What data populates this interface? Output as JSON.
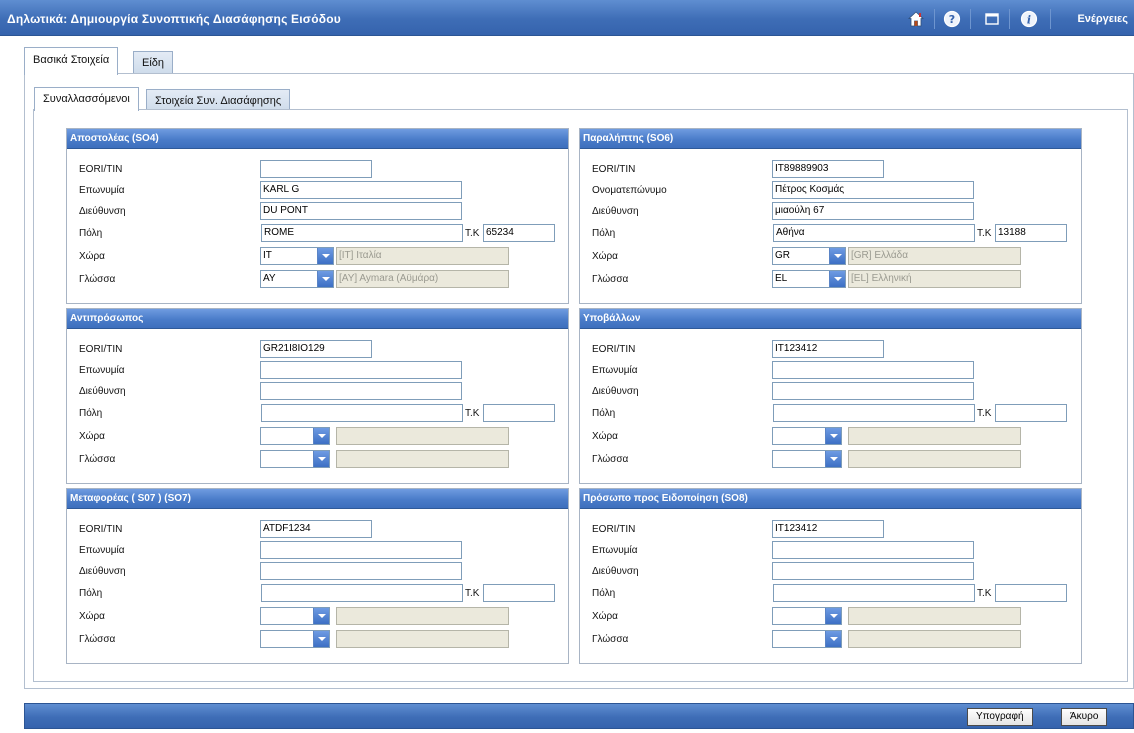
{
  "window": {
    "title": "Δηλωτικά: Δημιουργία Συνοπτικής Διασάφησης Εισόδου",
    "actions_label": "Ενέργειες",
    "icons": [
      "home-icon",
      "help-icon",
      "window-icon",
      "info-icon"
    ]
  },
  "tabs": {
    "main": [
      "Βασικά Στοιχεία",
      "Είδη"
    ],
    "sub": [
      "Συναλλασσόμενοι",
      "Στοιχεία Συν. Διασάφησης"
    ]
  },
  "labels": {
    "eori": "EORI/TIN",
    "eponymia": "Επωνυμία",
    "onomateponymo": "Ονοματεπώνυμο",
    "address": "Διεύθυνση",
    "city": "Πόλη",
    "postcode": "Τ.Κ",
    "country": "Χώρα",
    "language": "Γλώσσα"
  },
  "sections": {
    "sender": {
      "title": "Αποστολέας (SO4)",
      "eori": "",
      "name": "KARL G",
      "address": "DU PONT",
      "city": "ROME",
      "postcode": "65234",
      "country_code": "IT",
      "country_name": "[IT] Ιταλία",
      "language_code": "AY",
      "language_name": "[AY] Aymara (Αϋμάρα)"
    },
    "receiver": {
      "title": "Παραλήπτης (SO6)",
      "eori": "IT89889903",
      "name": "Πέτρος Κοσμάς",
      "address": "μιαούλη 67",
      "city": "Αθήνα",
      "postcode": "13188",
      "country_code": "GR",
      "country_name": "[GR] Ελλάδα",
      "language_code": "EL",
      "language_name": "[EL] Ελληνική"
    },
    "representative": {
      "title": "Αντιπρόσωπος",
      "eori": "GR21I8IO129",
      "name": "",
      "address": "",
      "city": "",
      "postcode": "",
      "country_code": "",
      "country_name": "",
      "language_code": "",
      "language_name": ""
    },
    "submitter": {
      "title": "Υποβάλλων",
      "eori": "IT123412",
      "name": "",
      "address": "",
      "city": "",
      "postcode": "",
      "country_code": "",
      "country_name": "",
      "language_code": "",
      "language_name": ""
    },
    "carrier": {
      "title": "Μεταφορέας ( S07 ) (SO7)",
      "eori": "ATDF1234",
      "name": "",
      "address": "",
      "city": "",
      "postcode": "",
      "country_code": "",
      "country_name": "",
      "language_code": "",
      "language_name": ""
    },
    "notify": {
      "title": "Πρόσωπο προς Ειδοποίηση (SO8)",
      "eori": "IT123412",
      "name": "",
      "address": "",
      "city": "",
      "postcode": "",
      "country_code": "",
      "country_name": "",
      "language_code": "",
      "language_name": ""
    }
  },
  "footer": {
    "sign_label": "Υπογραφή",
    "cancel_label": "Άκυρο"
  },
  "colors": {
    "header_blue": "#3e6db6",
    "section_header_blue": "#4a7cc9",
    "readonly_bg": "#ebe9dc"
  }
}
